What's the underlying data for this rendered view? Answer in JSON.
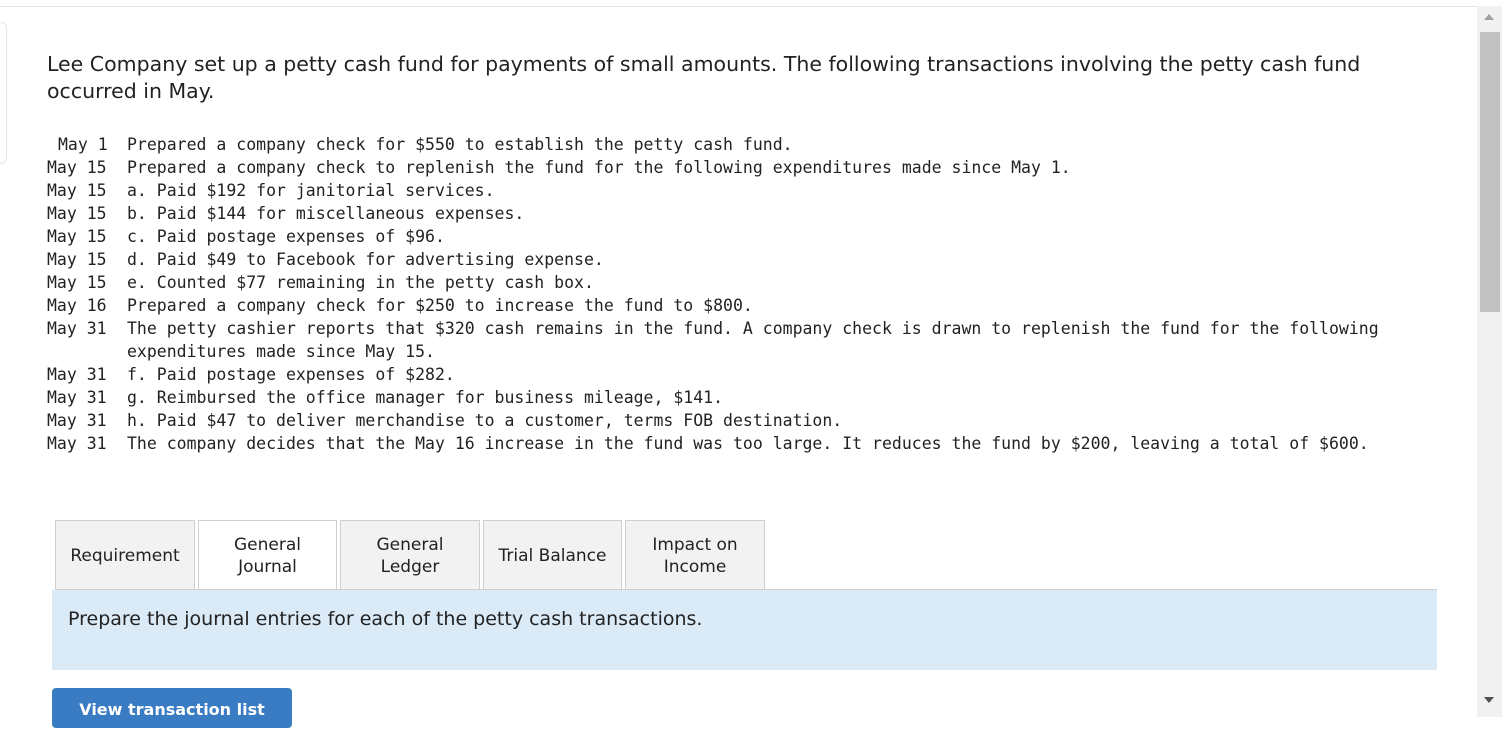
{
  "intro": "Lee Company set up a petty cash fund for payments of small amounts. The following transactions involving the petty cash fund occurred in May.",
  "transactions": [
    {
      "date": "May 1",
      "text": "Prepared a company check for $550 to establish the petty cash fund."
    },
    {
      "date": "May 15",
      "text": "Prepared a company check to replenish the fund for the following expenditures made since May 1."
    },
    {
      "date": "May 15",
      "text": "a. Paid $192 for janitorial services."
    },
    {
      "date": "May 15",
      "text": "b. Paid $144 for miscellaneous expenses."
    },
    {
      "date": "May 15",
      "text": "c. Paid postage expenses of $96."
    },
    {
      "date": "May 15",
      "text": "d. Paid $49 to Facebook for advertising expense."
    },
    {
      "date": "May 15",
      "text": "e. Counted $77 remaining in the petty cash box."
    },
    {
      "date": "May 16",
      "text": "Prepared a company check for $250 to increase the fund to $800."
    },
    {
      "date": "May 31",
      "text": "The petty cashier reports that $320 cash remains in the fund. A company check is drawn to replenish the fund for the following expenditures made since May 15."
    },
    {
      "date": "May 31",
      "text": "f. Paid postage expenses of $282."
    },
    {
      "date": "May 31",
      "text": "g. Reimbursed the office manager for business mileage, $141."
    },
    {
      "date": "May 31",
      "text": "h. Paid $47 to deliver merchandise to a customer, terms FOB destination."
    },
    {
      "date": "May 31",
      "text": "The company decides that the May 16 increase in the fund was too large. It reduces the fund by $200, leaving a total of $600."
    }
  ],
  "tabs": [
    {
      "line1": "Requirement",
      "line2": ""
    },
    {
      "line1": "General",
      "line2": "Journal"
    },
    {
      "line1": "General",
      "line2": "Ledger"
    },
    {
      "line1": "Trial Balance",
      "line2": ""
    },
    {
      "line1": "Impact on",
      "line2": "Income"
    }
  ],
  "panel_text": "Prepare the journal entries for each of the petty cash transactions.",
  "button_label": "View transaction list",
  "colors": {
    "panel_bg": "#dbeaf7",
    "button_bg": "#3a7cc4"
  }
}
